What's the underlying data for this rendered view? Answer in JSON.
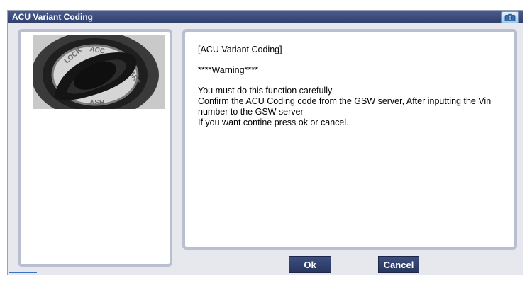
{
  "window": {
    "title": "ACU Variant Coding",
    "title_icon": "camera-icon"
  },
  "image_panel": {
    "image_description_icon": "ignition-key-switch-icon",
    "dial_labels": [
      "LOCK",
      "ACC",
      "START",
      "ASH"
    ]
  },
  "message": {
    "heading": "[ACU Variant Coding]",
    "warning": "****Warning****",
    "lines": [
      "You must do this function carefully",
      "Confirm the ACU Coding code from the GSW server, After inputting the Vin number to the GSW server",
      "If you want contine press ok or cancel."
    ]
  },
  "buttons": {
    "ok_label": "Ok",
    "cancel_label": "Cancel"
  }
}
